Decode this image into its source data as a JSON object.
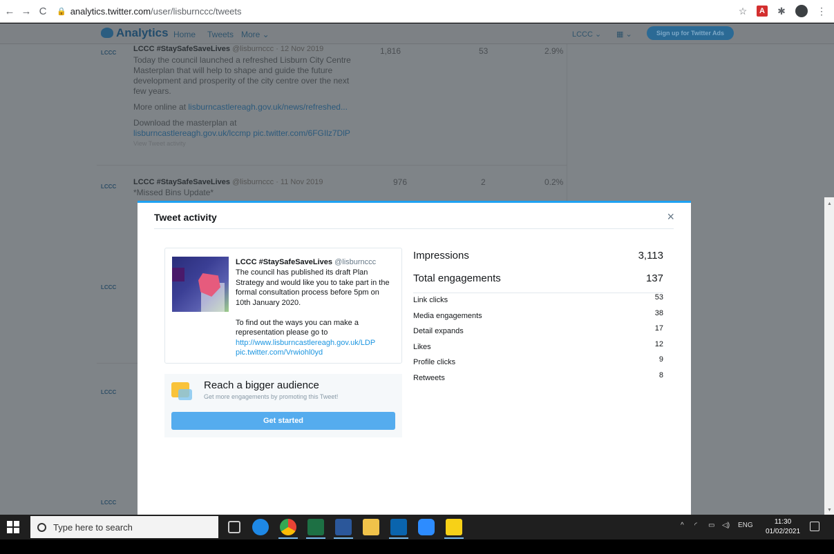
{
  "browser": {
    "back": "←",
    "forward": "→",
    "reload": "C",
    "url_host": "analytics.twitter.com",
    "url_path": "/user/lisburnccc/tweets"
  },
  "twitter_header": {
    "brand": "Analytics",
    "nav": [
      "Home",
      "Tweets",
      "More ⌄"
    ],
    "account": "LCCC ⌄",
    "ads_button": "Sign up for Twitter Ads"
  },
  "background_tweets": [
    {
      "name": "LCCC #StaySafeSaveLives",
      "meta": "@lisburnccc · 12 Nov 2019",
      "lines": [
        "Today the council launched a refreshed Lisburn City Centre",
        "Masterplan that will help to shape and guide the future",
        "development and prosperity of the city centre over the next",
        "few years."
      ],
      "more_prefix": "More online at ",
      "more_link": "lisburncastlereagh.gov.uk/news/refreshed...",
      "download": "Download the masterplan at",
      "download_link": "lisburncastlereagh.gov.uk/lccmp pic.twitter.com/6FGIlz7DlP",
      "activity": "View Tweet activity",
      "impressions": "1,816",
      "engagements": "53",
      "rate": "2.9%"
    },
    {
      "name": "LCCC #StaySafeSaveLives",
      "meta": "@lisburnccc · 11 Nov 2019",
      "lines": [
        "*Missed Bins Update*"
      ],
      "impressions": "976",
      "engagements": "2",
      "rate": "0.2%"
    }
  ],
  "modal": {
    "title": "Tweet activity",
    "close": "×",
    "tweet": {
      "author": "LCCC #StaySafeSaveLives",
      "handle": "@lisburnccc",
      "text": "The council has published its draft Plan\nStrategy and would like you to take part in the\nformal consultation process before 5pm on\n10th January 2020.\n\nTo find out the ways you can make a\nrepresentation please go to",
      "link1": "http://www.lisburncastlereagh.gov.uk/LDP",
      "link2": "pic.twitter.com/Vrwiohl0yd"
    },
    "promo": {
      "title": "Reach a bigger audience",
      "subtitle": "Get more engagements by promoting this Tweet!",
      "button": "Get started"
    },
    "metrics": {
      "impressions_label": "Impressions",
      "impressions_value": "3,113",
      "engagements_label": "Total engagements",
      "engagements_value": "137",
      "rows": [
        {
          "label": "Link clicks",
          "value": "53"
        },
        {
          "label": "Media engagements",
          "value": "38"
        },
        {
          "label": "Detail expands",
          "value": "17"
        },
        {
          "label": "Likes",
          "value": "12"
        },
        {
          "label": "Profile clicks",
          "value": "9"
        },
        {
          "label": "Retweets",
          "value": "8"
        }
      ]
    }
  },
  "taskbar": {
    "search_placeholder": "Type here to search",
    "tray_lang": "ENG",
    "time": "11:30",
    "date": "01/02/2021"
  }
}
